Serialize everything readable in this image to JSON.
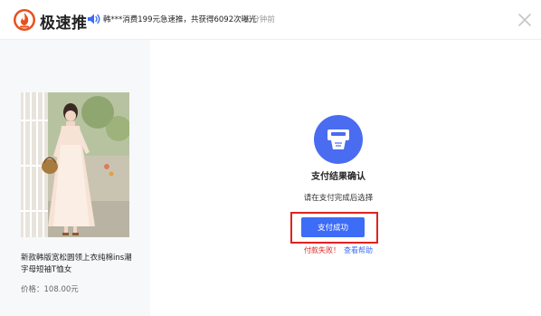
{
  "header": {
    "brand": "极速推",
    "logo_icon": "fire-badge-icon",
    "notice_icon": "speaker-icon",
    "notice_text": "韩***消费199元急速推，共获得6092次曝光",
    "notice_time": "3分钟前",
    "close_icon": "close-icon"
  },
  "product": {
    "image": "product-photo-woman-dress",
    "title": "新款韩版宽松圆领上衣纯棉ins潮字母短袖T恤女",
    "price_label": "价格：",
    "price": "108.00元"
  },
  "result": {
    "icon": "payment-terminal-icon",
    "title": "支付结果确认",
    "subtitle": "请在支付完成后选择",
    "success_button": "支付成功",
    "fail_link": "付款失败！",
    "help_link": "查看帮助"
  },
  "colors": {
    "accent": "#3d6cf6",
    "highlight": "#e12121",
    "panel_bg": "#f7f8fa"
  }
}
